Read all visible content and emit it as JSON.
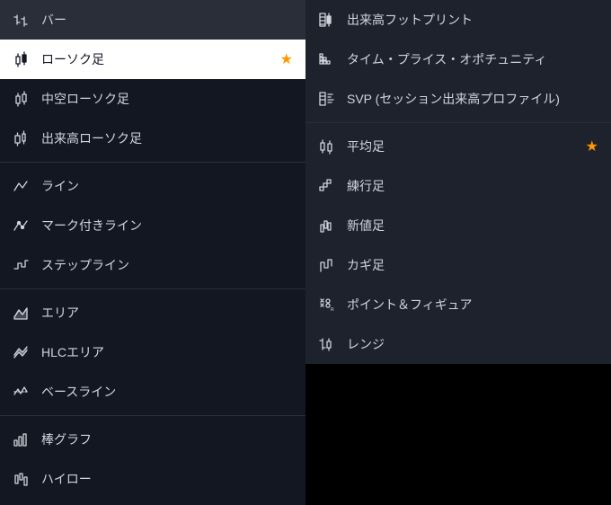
{
  "left": {
    "groups": [
      {
        "items": [
          {
            "id": "bar",
            "label": "バー",
            "icon": "bar"
          },
          {
            "id": "candle",
            "label": "ローソク足",
            "icon": "candle",
            "selected": true,
            "starred": true
          },
          {
            "id": "hollow-candle",
            "label": "中空ローソク足",
            "icon": "hollow-candle"
          },
          {
            "id": "volume-candle",
            "label": "出来高ローソク足",
            "icon": "volume-candle"
          }
        ]
      },
      {
        "items": [
          {
            "id": "line",
            "label": "ライン",
            "icon": "line"
          },
          {
            "id": "marked-line",
            "label": "マーク付きライン",
            "icon": "marked-line"
          },
          {
            "id": "step-line",
            "label": "ステップライン",
            "icon": "step-line"
          }
        ]
      },
      {
        "items": [
          {
            "id": "area",
            "label": "エリア",
            "icon": "area"
          },
          {
            "id": "hlc-area",
            "label": "HLCエリア",
            "icon": "hlc-area"
          },
          {
            "id": "baseline",
            "label": "ベースライン",
            "icon": "baseline"
          }
        ]
      },
      {
        "items": [
          {
            "id": "column",
            "label": "棒グラフ",
            "icon": "column"
          },
          {
            "id": "hilo",
            "label": "ハイロー",
            "icon": "hilo"
          }
        ]
      }
    ]
  },
  "right": {
    "groups": [
      {
        "items": [
          {
            "id": "volume-footprint",
            "label": "出来高フットプリント",
            "icon": "footprint"
          },
          {
            "id": "tpo",
            "label": "タイム・プライス・オポチュニティ",
            "icon": "tpo"
          },
          {
            "id": "svp",
            "label": "SVP (セッション出来高プロファイル)",
            "icon": "svp"
          }
        ]
      },
      {
        "items": [
          {
            "id": "heikin-ashi",
            "label": "平均足",
            "icon": "heikin",
            "starred": true
          },
          {
            "id": "renko",
            "label": "練行足",
            "icon": "renko"
          },
          {
            "id": "line-break",
            "label": "新値足",
            "icon": "linebreak"
          },
          {
            "id": "kagi",
            "label": "カギ足",
            "icon": "kagi"
          },
          {
            "id": "pnf",
            "label": "ポイント＆フィギュア",
            "icon": "pnf"
          },
          {
            "id": "range",
            "label": "レンジ",
            "icon": "range"
          }
        ]
      }
    ]
  }
}
